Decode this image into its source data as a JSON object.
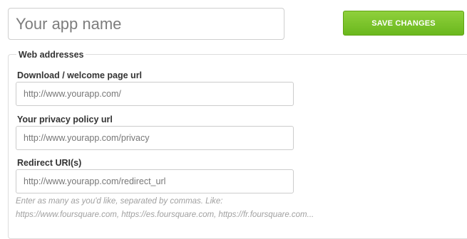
{
  "header": {
    "app_name_placeholder": "Your app name",
    "save_label": "SAVE CHANGES"
  },
  "web_addresses": {
    "legend": "Web addresses",
    "download_url": {
      "label": "Download / welcome page url",
      "placeholder": "http://www.yourapp.com/"
    },
    "privacy_url": {
      "label": "Your privacy policy url",
      "placeholder": "http://www.yourapp.com/privacy"
    },
    "redirect_uri": {
      "label": "Redirect URI(s)",
      "placeholder": "http://www.yourapp.com/redirect_url",
      "help_line1": "Enter as many as you'd like, separated by commas. Like:",
      "help_line2": "https://www.foursquare.com, https://es.foursquare.com, https://fr.foursquare.com..."
    }
  },
  "colors": {
    "save_button": "#79c22a",
    "label_text": "#333333",
    "help_text": "#a0a0a0"
  }
}
